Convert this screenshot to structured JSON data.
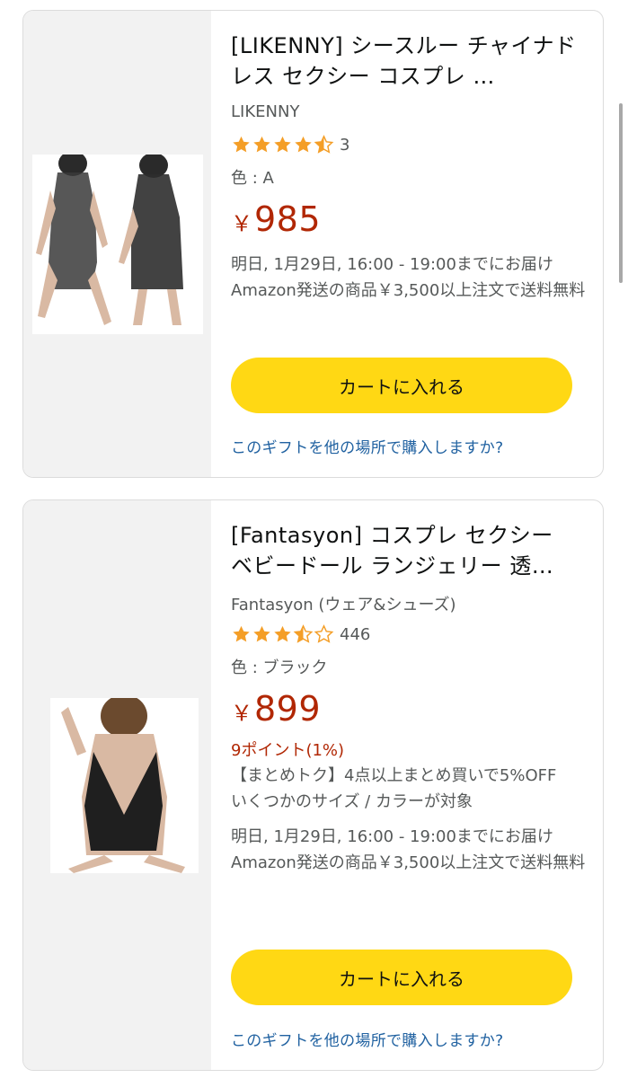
{
  "colors": {
    "price": "#B12704",
    "cart_button": "#FFD814",
    "link": "#2162A1",
    "star": "#F49E27",
    "muted_text": "#565959"
  },
  "products": [
    {
      "title": "[LIKENNY] シースルー チャイナドレス セクシー コスプレ …",
      "brand": "LIKENNY",
      "rating": 4.5,
      "rating_count": "3",
      "variant": "色 : A",
      "currency": "￥",
      "price": "985",
      "points": "",
      "promo": "",
      "delivery": "明日, 1月29日, 16:00 - 19:00までにお届け Amazon発送の商品￥3,500以上注文で送料無料",
      "cart_label": "カートに入れる",
      "gift_link": "このギフトを他の場所で購入しますか?",
      "image_icon": "product-photo-black-sheer-china-dress"
    },
    {
      "title": "[Fantasyon] コスプレ セクシー ベビードール ランジェリー 透…",
      "brand": "Fantasyon (ウェア&シューズ)",
      "rating": 3.5,
      "rating_count": "446",
      "variant": "色 : ブラック",
      "currency": "￥",
      "price": "899",
      "points": "9ポイント(1%)",
      "promo": "【まとめトク】4点以上まとめ買いで5%OFF いくつかのサイズ / カラーが対象",
      "delivery": "明日, 1月29日, 16:00 - 19:00までにお届け Amazon発送の商品￥3,500以上注文で送料無料",
      "cart_label": "カートに入れる",
      "gift_link": "このギフトを他の場所で購入しますか?",
      "image_icon": "product-photo-black-lace-babydoll"
    }
  ]
}
